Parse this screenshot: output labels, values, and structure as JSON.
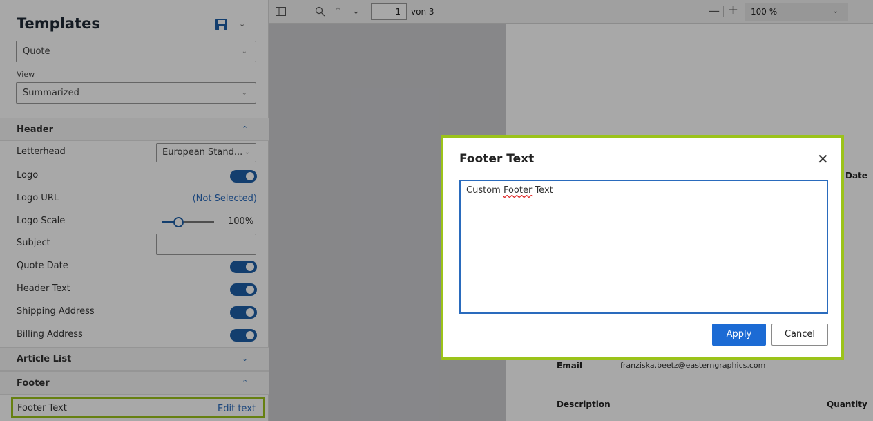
{
  "sidebar": {
    "title": "Templates",
    "template_select": "Quote",
    "view_label": "View",
    "view_select": "Summarized",
    "sections": {
      "header": {
        "label": "Header",
        "rows": {
          "letterhead": {
            "label": "Letterhead",
            "value": "European Stand..."
          },
          "logo": {
            "label": "Logo",
            "enabled": true
          },
          "logo_url": {
            "label": "Logo URL",
            "value": "(Not Selected)"
          },
          "logo_scale": {
            "label": "Logo Scale",
            "value": "100%",
            "fraction": 0.25
          },
          "subject": {
            "label": "Subject",
            "value": ""
          },
          "quote_date": {
            "label": "Quote Date",
            "enabled": true
          },
          "header_text": {
            "label": "Header Text",
            "enabled": true
          },
          "shipping_address": {
            "label": "Shipping Address",
            "enabled": true
          },
          "billing_address": {
            "label": "Billing Address",
            "enabled": true
          }
        }
      },
      "article_list": {
        "label": "Article List"
      },
      "footer": {
        "label": "Footer",
        "footer_text": {
          "label": "Footer Text",
          "action": "Edit text"
        }
      }
    }
  },
  "toolbar": {
    "page_current": "1",
    "page_total": "von 3",
    "zoom": "100 %"
  },
  "document": {
    "date_label": "Date",
    "email_label": "Email",
    "email_value": "franziska.beetz@easterngraphics.com",
    "description_label": "Description",
    "quantity_label": "Quantity"
  },
  "dialog": {
    "title": "Footer Text",
    "text_before": "Custom ",
    "text_misspelled": "Footer",
    "text_after": " Text",
    "apply": "Apply",
    "cancel": "Cancel"
  },
  "colors": {
    "accent": "#1d5fa8",
    "highlight": "#9bc31a",
    "link": "#2a6bbd",
    "apply_button": "#1c6bd4"
  }
}
